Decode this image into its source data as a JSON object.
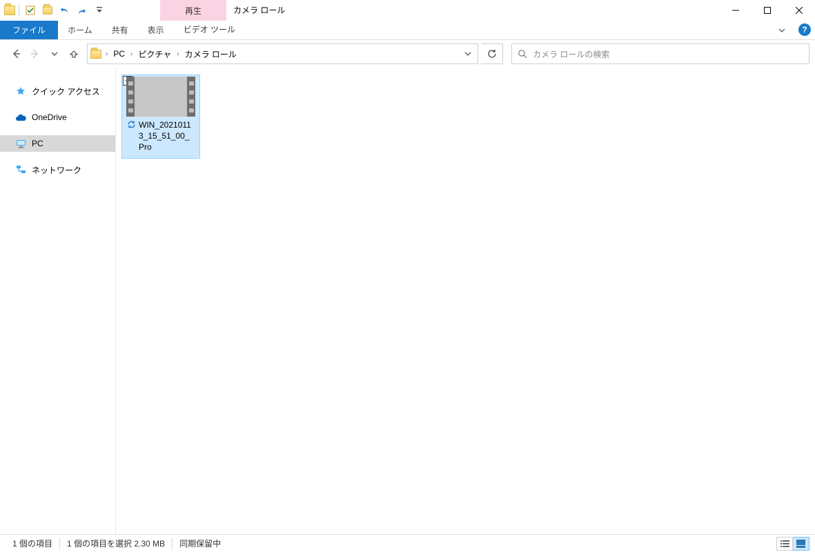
{
  "window": {
    "title": "カメラ ロール",
    "contextual_tab_title": "再生"
  },
  "qat": {
    "undo_tip": "元に戻す",
    "redo_tip": "やり直し"
  },
  "ribbon": {
    "file": "ファイル",
    "tabs": [
      "ホーム",
      "共有",
      "表示"
    ],
    "context_tab": "ビデオ ツール"
  },
  "breadcrumbs": [
    "PC",
    "ピクチャ",
    "カメラ ロール"
  ],
  "search": {
    "placeholder": "カメラ ロールの検索"
  },
  "nav_items": [
    {
      "label": "クイック アクセス",
      "icon": "star",
      "selected": false
    },
    {
      "label": "OneDrive",
      "icon": "cloud",
      "selected": false
    },
    {
      "label": "PC",
      "icon": "pc",
      "selected": true
    },
    {
      "label": "ネットワーク",
      "icon": "network",
      "selected": false
    }
  ],
  "files": [
    {
      "name": "WIN_20210113_15_51_00_Pro",
      "selected": true,
      "checked": true,
      "sync_pending": true
    }
  ],
  "status": {
    "count": "1 個の項目",
    "selection": "1 個の項目を選択 2.30 MB",
    "sync": "同期保留中"
  }
}
